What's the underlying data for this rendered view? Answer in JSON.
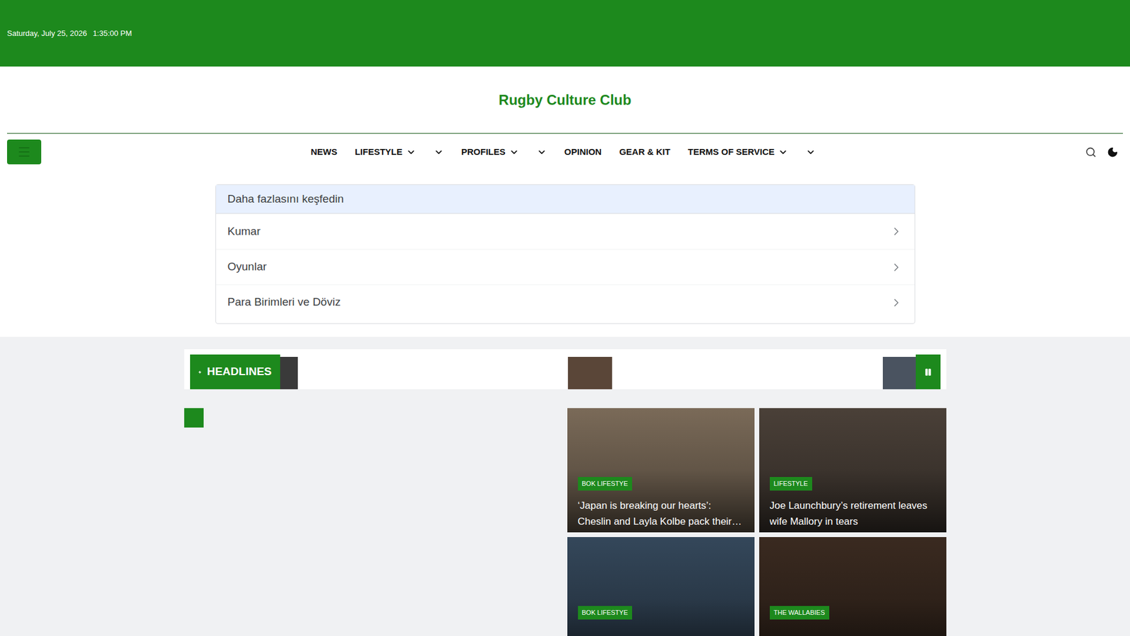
{
  "top_bar": {
    "date": "Saturday, July 25, 2026",
    "time": "1:35:00 PM"
  },
  "site_title": "Rugby Culture Club",
  "nav": [
    {
      "kind": "link",
      "label": "NEWS",
      "dropdown": false
    },
    {
      "kind": "link",
      "label": "LIFESTYLE",
      "dropdown": true
    },
    {
      "kind": "chevron-only",
      "label": "",
      "dropdown": true
    },
    {
      "kind": "link",
      "label": "PROFILES",
      "dropdown": true
    },
    {
      "kind": "chevron-only",
      "label": "",
      "dropdown": true
    },
    {
      "kind": "link",
      "label": "OPINION",
      "dropdown": false
    },
    {
      "kind": "link",
      "label": "GEAR & KIT",
      "dropdown": false
    },
    {
      "kind": "link",
      "label": "TERMS OF SERVICE",
      "dropdown": true
    },
    {
      "kind": "chevron-only",
      "label": "",
      "dropdown": true
    }
  ],
  "explore": {
    "title": "Daha fazlasını keşfedin",
    "items": [
      "Kumar",
      "Oyunlar",
      "Para Birimleri ve Döviz"
    ]
  },
  "headlines": {
    "label": "HEADLINES",
    "paused": false
  },
  "cards": [
    {
      "badge": "BOK LIFESTYE",
      "title": "‘Japan is breaking our hearts’: Cheslin and Layla Kolbe pack their…",
      "color": "#7a6a58"
    },
    {
      "badge": "LIFESTYLE",
      "title": "Joe Launchbury’s retirement leaves wife Mallory in tears",
      "color": "#4a4038"
    },
    {
      "badge": "BOK LIFESTYE",
      "title": "",
      "color": "#34475a"
    },
    {
      "badge": "THE WALLABIES",
      "title": "",
      "color": "#3a2a20"
    }
  ]
}
